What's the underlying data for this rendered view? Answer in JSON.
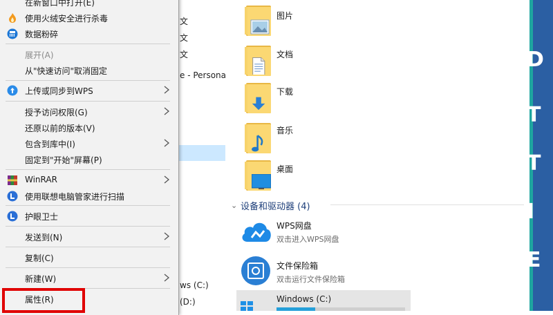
{
  "nav": {
    "fragments": [
      "文",
      "文",
      "文",
      "e - Personal",
      "ws (C:)",
      "(D:)"
    ]
  },
  "folders": [
    {
      "label": "图片",
      "icon": "pictures-folder-icon"
    },
    {
      "label": "文档",
      "icon": "documents-folder-icon"
    },
    {
      "label": "下载",
      "icon": "downloads-folder-icon"
    },
    {
      "label": "音乐",
      "icon": "music-folder-icon"
    },
    {
      "label": "桌面",
      "icon": "desktop-folder-icon"
    }
  ],
  "section": {
    "title": "设备和驱动器 (4)"
  },
  "devices": [
    {
      "name": "WPS网盘",
      "sub": "双击进入WPS网盘",
      "icon": "wps-cloud-icon"
    },
    {
      "name": "文件保险箱",
      "sub": "双击运行文件保险箱",
      "icon": "file-safe-icon"
    },
    {
      "name": "Windows (C:)",
      "icon": "windows-drive-icon",
      "usage_fraction": 0.3
    }
  ],
  "side_strip": {
    "chars": [
      "D",
      "T",
      "T",
      "I",
      "E"
    ]
  },
  "menu": {
    "items": [
      {
        "label": "在新窗口中打开(E)",
        "icon": ""
      },
      {
        "label": "使用火绒安全进行杀毒",
        "icon": "huorong-flame-icon"
      },
      {
        "label": "数据粉碎",
        "icon": "data-shred-icon"
      },
      {
        "label": "展开(A)",
        "disabled": true
      },
      {
        "label": "从\"快速访问\"取消固定"
      },
      {
        "label": "上传或同步到WPS",
        "icon": "wps-cloud-upload-icon",
        "submenu": true
      },
      {
        "label": "授予访问权限(G)",
        "submenu": true
      },
      {
        "label": "还原以前的版本(V)"
      },
      {
        "label": "包含到库中(I)",
        "submenu": true
      },
      {
        "label": "固定到\"开始\"屏幕(P)"
      },
      {
        "label": "WinRAR",
        "icon": "winrar-icon",
        "submenu": true
      },
      {
        "label": "使用联想电脑管家进行扫描",
        "icon": "lenovo-manager-icon"
      },
      {
        "label": "护眼卫士",
        "icon": "eye-guard-icon"
      },
      {
        "label": "发送到(N)",
        "submenu": true
      },
      {
        "label": "复制(C)"
      },
      {
        "label": "新建(W)",
        "submenu": true
      },
      {
        "label": "属性(R)"
      }
    ]
  },
  "colors": {
    "accent_blue": "#26a0da",
    "highlight_red": "#e00000",
    "section_title": "#1e3f7a",
    "folder_yellow": "#fbd873"
  }
}
